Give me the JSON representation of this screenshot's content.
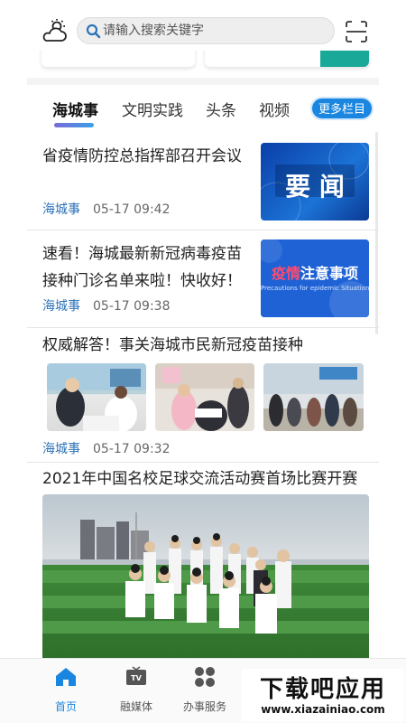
{
  "header": {
    "search_placeholder": "请输入搜索关键字",
    "weather_icon": "weather-icon",
    "scan_icon": "scan-icon"
  },
  "tabs": {
    "items": [
      "海城事",
      "文明实践",
      "头条",
      "视频"
    ],
    "active": "海城事",
    "more_label": "更多栏目"
  },
  "articles": [
    {
      "title": "省疫情防控总指挥部召开会议",
      "source": "海城事",
      "time": "05-17 09:42",
      "thumb_text": "要 闻"
    },
    {
      "title_line1": "速看！海城最新新冠病毒疫苗",
      "title_line2": "接种门诊名单来啦！快收好！",
      "source": "海城事",
      "time": "05-17 09:38",
      "thumb_text": "疫情注意事项",
      "thumb_subtext": "Precautions for epidemic Situation"
    },
    {
      "title": "权威解答！事关海城市民新冠疫苗接种",
      "source": "海城事",
      "time": "05-17 09:32"
    },
    {
      "title": "2021年中国名校足球交流活动赛首场比赛开赛"
    }
  ],
  "bottom_nav": [
    {
      "label": "首页",
      "icon": "home-icon",
      "active": true
    },
    {
      "label": "融媒体",
      "icon": "tv-icon",
      "active": false
    },
    {
      "label": "办事服务",
      "icon": "grid-icon",
      "active": false
    }
  ],
  "watermark": {
    "line1": "下载吧应用",
    "line2": "www.xiazainiao.com"
  },
  "colors": {
    "accent": "#1a86e0",
    "source_link": "#2d72b8",
    "teal": "#1aa998"
  }
}
